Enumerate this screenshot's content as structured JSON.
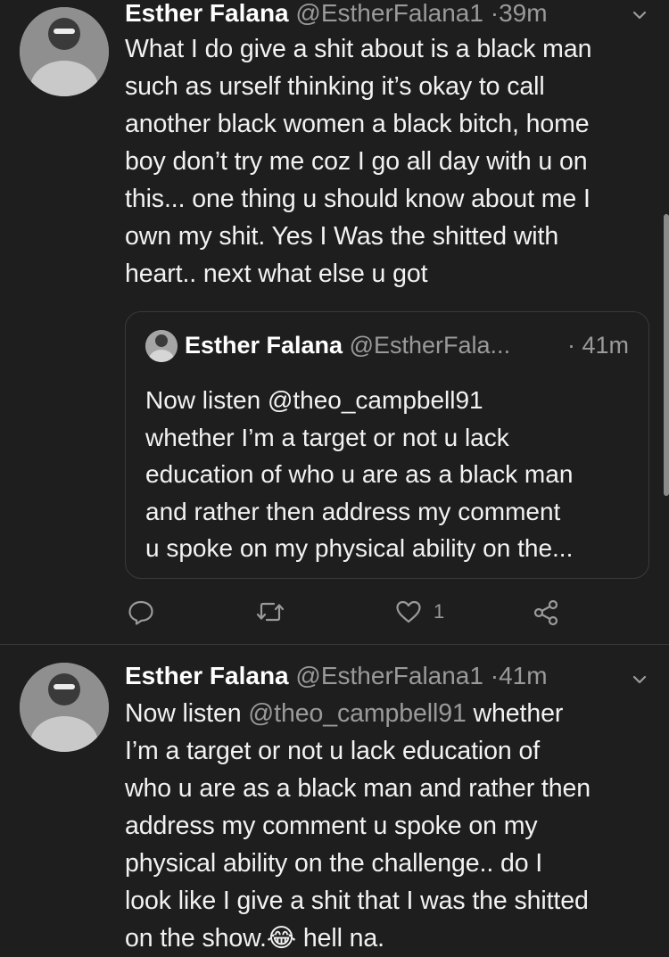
{
  "tweet1": {
    "name": "Esther Falana",
    "handle": "@EstherFalana1",
    "separator": "·",
    "time": "39m",
    "lines": [
      "What I do give a shit about is a black man",
      "such as urself thinking it’s okay to call",
      "another black women a black bitch, home",
      "boy don’t try me coz I go all day with u on",
      "this... one thing u should know about me I",
      "own my shit. Yes I Was the shitted with",
      "heart.. next what else u got"
    ],
    "quote": {
      "name": "Esther Falana",
      "handle": "@EstherFala...",
      "time": "· 41m",
      "lines": [
        "Now listen @theo_campbell91",
        "whether I’m a target or not u lack",
        "education of who u are as a black man",
        "and rather then address my comment",
        "u spoke on my physical ability on the..."
      ]
    },
    "actions": {
      "like_count": "1"
    }
  },
  "tweet2": {
    "name": "Esther Falana",
    "handle": "@EstherFalana1",
    "separator": "·",
    "time": "41m",
    "line1_prefix": "Now listen ",
    "line1_mention": "@theo_campbell91",
    "line1_suffix": " whether",
    "lines": [
      "I’m a target or not u lack education of",
      "who u are as a black man and rather then",
      "address my comment u spoke on my",
      "physical ability on the challenge.. do I",
      "look like I give a shit that I was the shitted"
    ],
    "last_line_prefix": "on the show.",
    "emoji": "😂",
    "last_line_suffix": " hell na."
  },
  "colors": {
    "background": "#1e1e1e",
    "text": "#f2f2f2",
    "secondary": "#9a9a9a",
    "border": "#3a3a3a"
  }
}
